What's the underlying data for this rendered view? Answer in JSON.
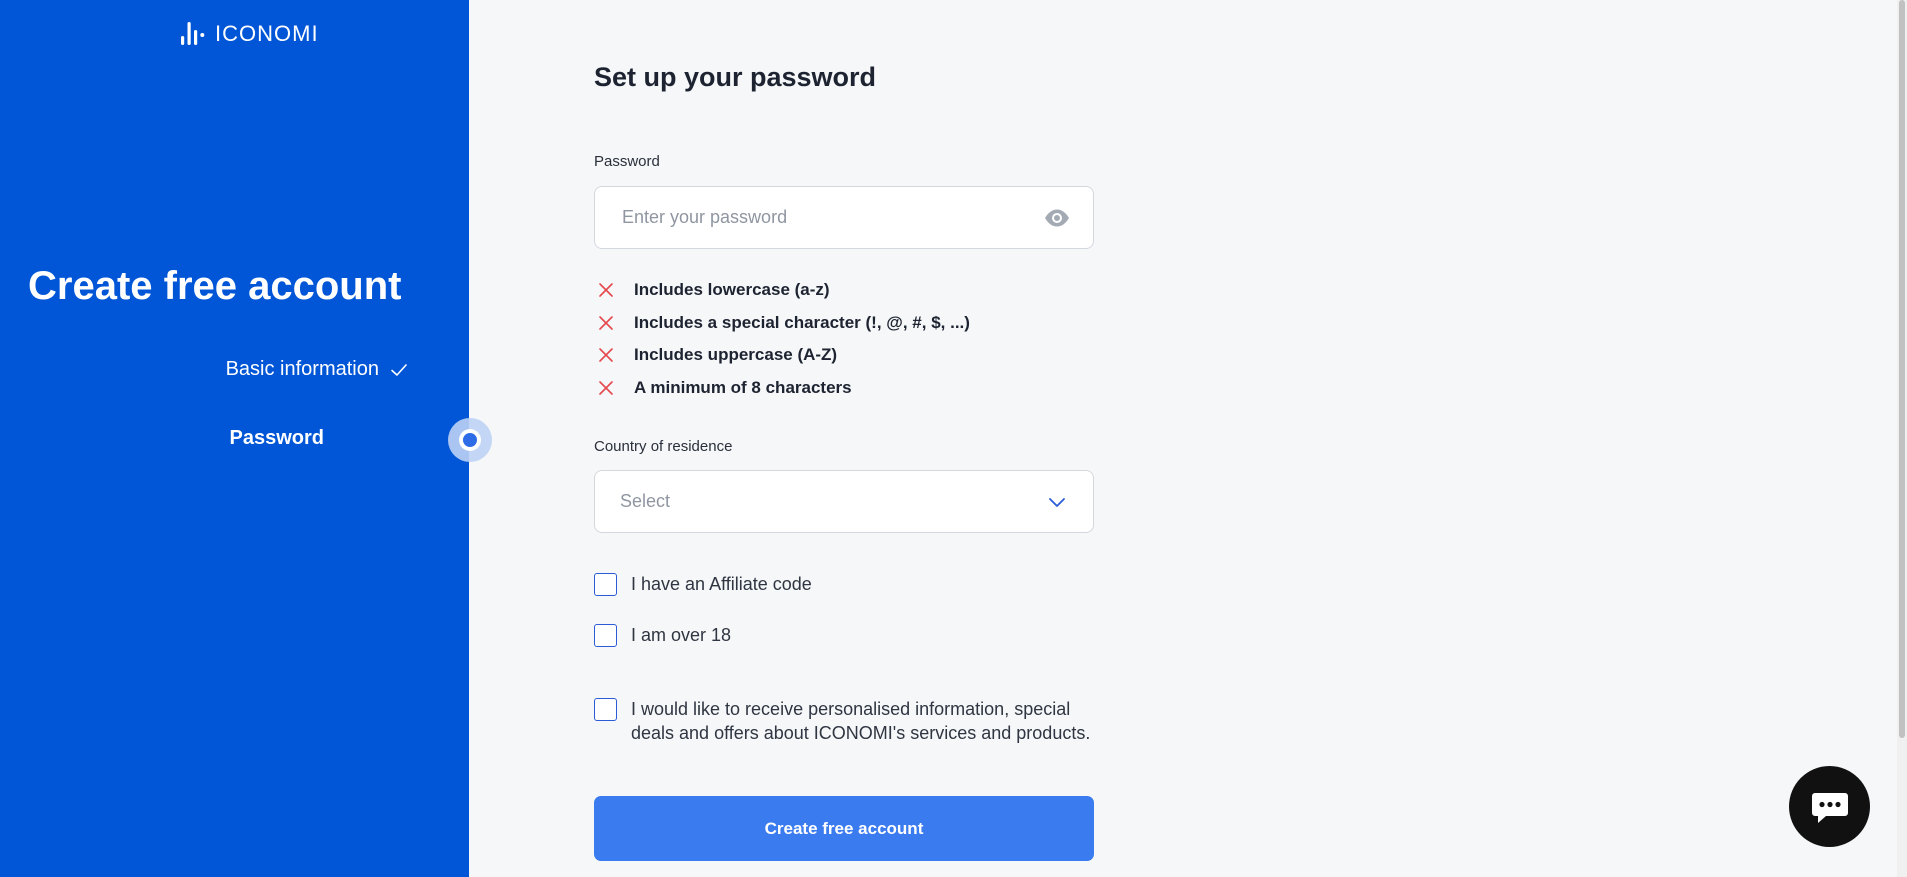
{
  "brand": {
    "name": "ICONOMI",
    "accent": "#0056d6"
  },
  "sidebar": {
    "title": "Create free account",
    "steps": [
      {
        "label": "Basic information",
        "status": "completed",
        "icon": "check-icon"
      },
      {
        "label": "Password",
        "status": "current"
      }
    ]
  },
  "form": {
    "title": "Set up your password",
    "password": {
      "label": "Password",
      "placeholder": "Enter your password",
      "value": "",
      "toggle_icon": "eye-icon"
    },
    "rules": [
      {
        "text": "Includes lowercase (a-z)",
        "met": false
      },
      {
        "text": "Includes a special character (!, @, #, $, ...)",
        "met": false
      },
      {
        "text": "Includes uppercase (A-Z)",
        "met": false
      },
      {
        "text": "A minimum of 8 characters",
        "met": false
      }
    ],
    "country": {
      "label": "Country of residence",
      "selected": "Select",
      "icon": "chevron-down-icon"
    },
    "checkboxes": {
      "affiliate": {
        "label": "I have an Affiliate code",
        "checked": false
      },
      "age": {
        "label": "I am over 18",
        "checked": false
      },
      "marketing": {
        "label": "I would like to receive personalised information, special deals and offers about ICONOMI's services and products.",
        "checked": false
      }
    },
    "submit_label": "Create free account"
  },
  "chat": {
    "icon": "chat-icon"
  },
  "colors": {
    "sidebar_bg": "#0056d6",
    "button_bg": "#3a7bef",
    "error": "#e5484d",
    "page_bg": "#f5f7f9"
  }
}
